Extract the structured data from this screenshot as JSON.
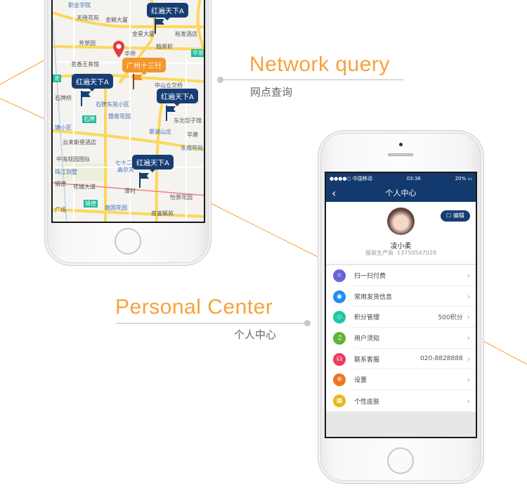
{
  "sections": {
    "network": {
      "title_en": "Network query",
      "title_cn": "网点查询"
    },
    "personal": {
      "title_en": "Personal Center",
      "title_cn": "个人中心"
    }
  },
  "map": {
    "markers": [
      {
        "label": "红遍天下A",
        "color": "#173e74"
      },
      {
        "label": "红遍天下A",
        "color": "#173e74"
      },
      {
        "label": "红遍天下A",
        "color": "#173e74"
      },
      {
        "label": "红遍天下A",
        "color": "#173e74"
      },
      {
        "label": "广州十三行",
        "color": "#f5952a"
      }
    ],
    "labels": [
      "职业学院",
      "天晓花苑",
      "金颖大厦",
      "金星大厦",
      "裕发酒店",
      "芳草园",
      "华师",
      "翰景轩",
      "茗香王茶馆",
      "中山立交桥",
      "石牌桥",
      "石牌东苑小区",
      "暨南花园",
      "东北饺子馆",
      "塘小区",
      "翠湖山庄",
      "华建",
      "云来斯堡酒店",
      "东成花苑",
      "中海观园国际",
      "七十二",
      "高尔夫",
      "珠江别墅",
      "猎德",
      "花城大道",
      "潭村",
      "怡景花园",
      "南国花园",
      "广场",
      "南富颖苑",
      "华景",
      "石牌",
      "猎德",
      "龙"
    ]
  },
  "personal_screen": {
    "status": {
      "carrier": "●●●●○ 中国移动",
      "time": "03:36",
      "battery": "20%"
    },
    "nav_title": "个人中心",
    "edit_label": "编辑",
    "user": {
      "name": "凌小柔",
      "role": "服装生产商",
      "phone": "13750547028"
    },
    "menu": [
      {
        "label": "扫一扫付费",
        "value": "",
        "icon": "scan-icon",
        "color": "#6a63d8"
      },
      {
        "label": "常用发货信息",
        "value": "",
        "icon": "location-icon",
        "color": "#1e8ef0"
      },
      {
        "label": "积分管理",
        "value": "500积分",
        "icon": "tag-icon",
        "color": "#1fc7a4"
      },
      {
        "label": "用户须知",
        "value": "",
        "icon": "bell-icon",
        "color": "#62b035"
      },
      {
        "label": "联系客服",
        "value": "020-8828888",
        "icon": "headset-icon",
        "color": "#f03a5a"
      },
      {
        "label": "设置",
        "value": "",
        "icon": "gear-icon",
        "color": "#f27421"
      },
      {
        "label": "个性皮肤",
        "value": "",
        "icon": "grid-icon",
        "color": "#eab61b"
      }
    ]
  }
}
